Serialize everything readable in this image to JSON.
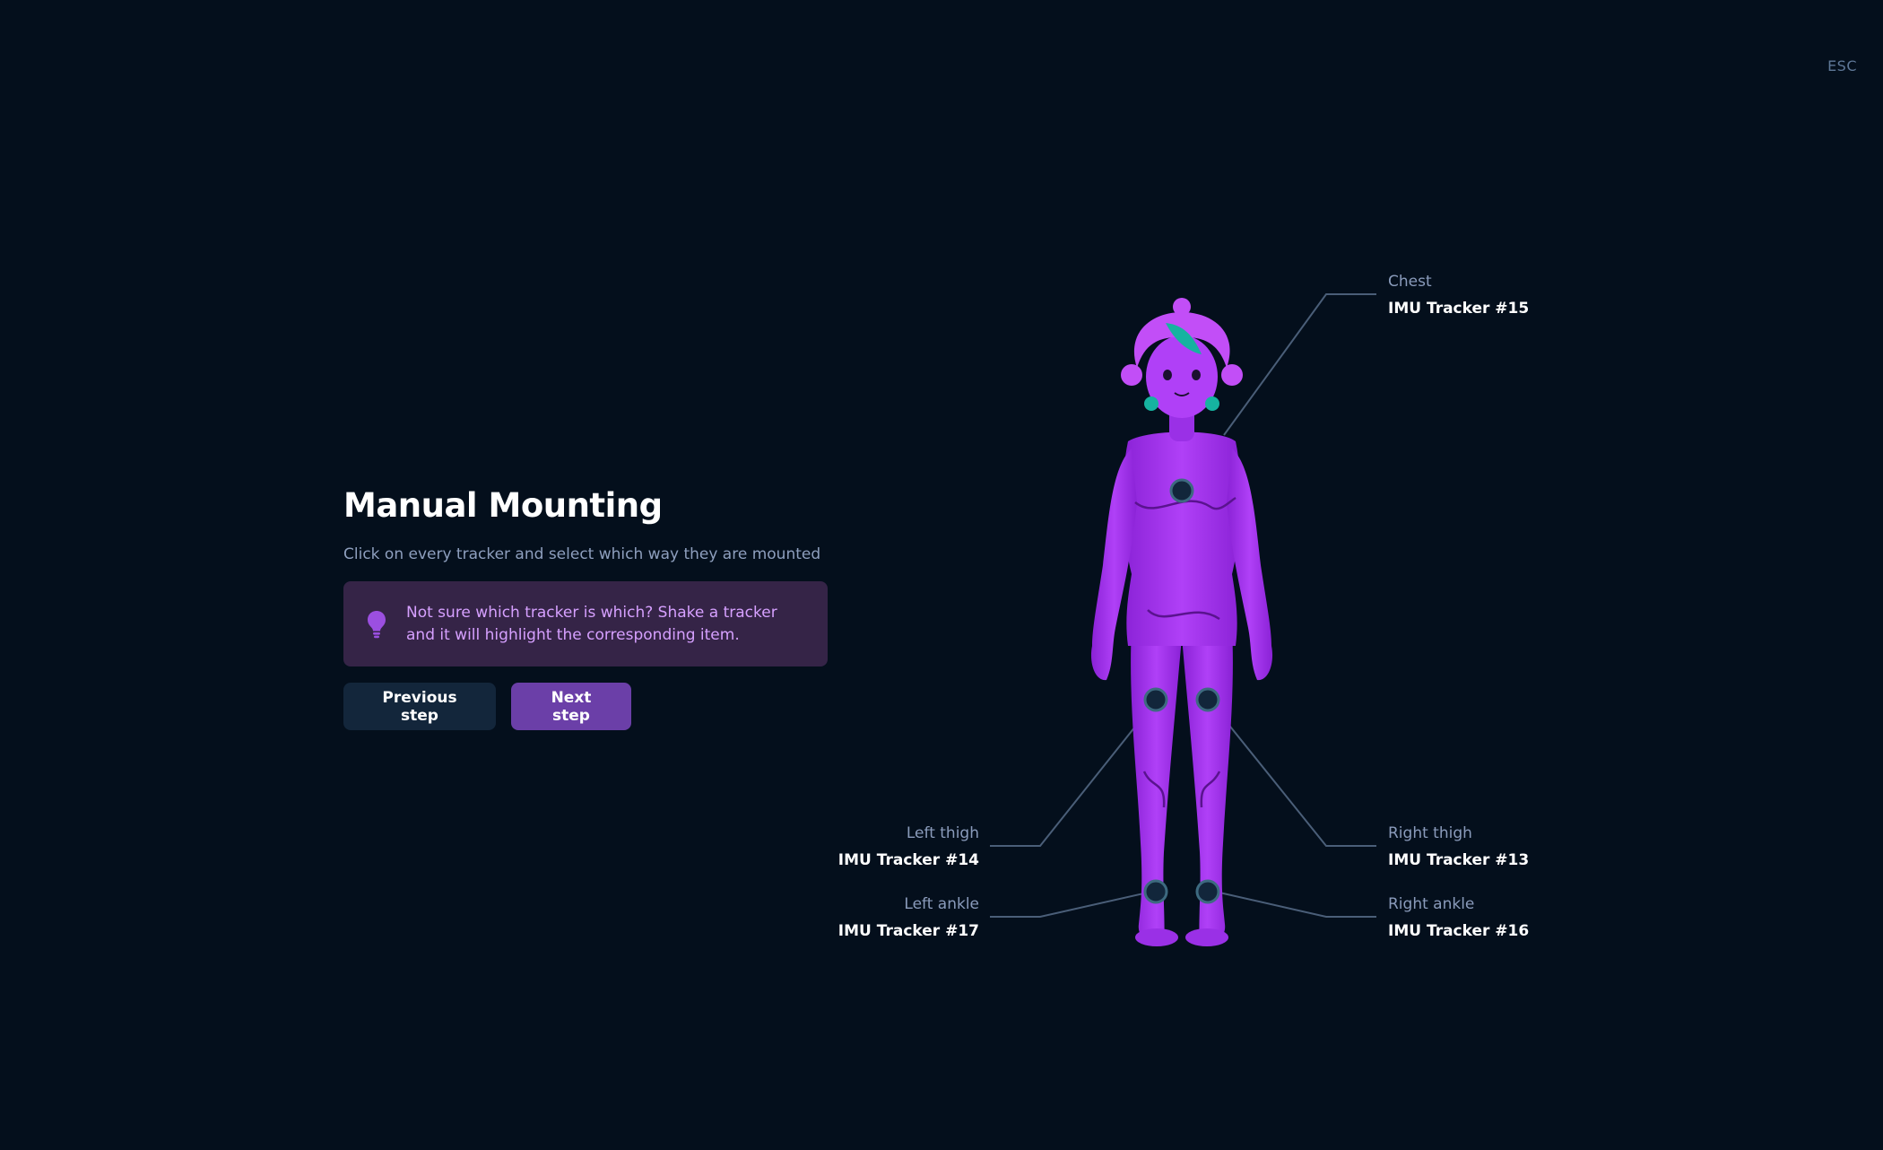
{
  "esc_label": "ESC",
  "title": "Manual Mounting",
  "subtitle": "Click on every tracker and select which way they are mounted",
  "tip": {
    "icon": "lightbulb-icon",
    "line1": "Not sure which tracker is which? Shake a tracker",
    "line2": "and it will highlight the corresponding item."
  },
  "buttons": {
    "previous": "Previous step",
    "next": "Next step"
  },
  "trackers": {
    "chest": {
      "part": "Chest",
      "name": "IMU Tracker #15"
    },
    "left_thigh": {
      "part": "Left thigh",
      "name": "IMU Tracker #14"
    },
    "right_thigh": {
      "part": "Right thigh",
      "name": "IMU Tracker #13"
    },
    "left_ankle": {
      "part": "Left ankle",
      "name": "IMU Tracker #17"
    },
    "right_ankle": {
      "part": "Right ankle",
      "name": "IMU Tracker #16"
    }
  },
  "colors": {
    "background": "#040f1c",
    "accent": "#6b3fa8",
    "body": "#a530f0",
    "hair_accent": "#16b3a0"
  }
}
